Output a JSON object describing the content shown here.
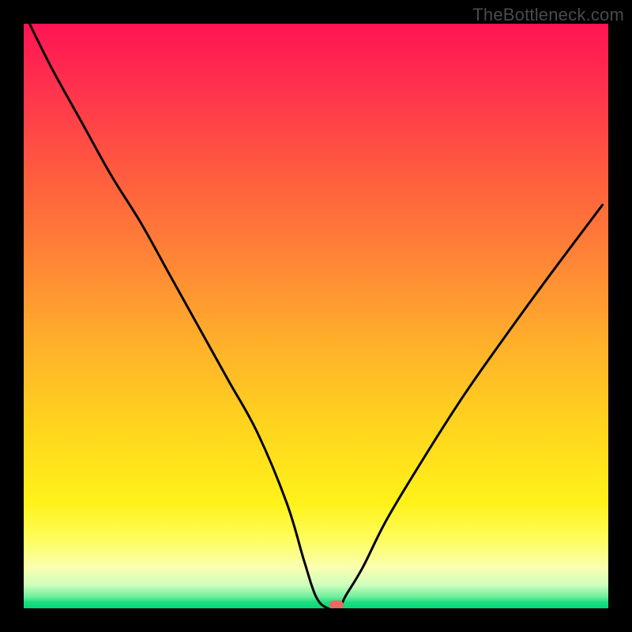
{
  "watermark": "TheBottleneck.com",
  "colors": {
    "curve": "#000000",
    "marker": "#e76b63",
    "frame": "#000000"
  },
  "chart_data": {
    "type": "line",
    "title": "",
    "xlabel": "",
    "ylabel": "",
    "xlim": [
      0,
      100
    ],
    "ylim": [
      0,
      100
    ],
    "grid": false,
    "annotations": [
      "TheBottleneck.com"
    ],
    "series": [
      {
        "name": "bottleneck-curve",
        "x": [
          1,
          5,
          10,
          15,
          20,
          25,
          30,
          35,
          40,
          45,
          48,
          50,
          52,
          54,
          55,
          58,
          62,
          68,
          75,
          82,
          90,
          99
        ],
        "y": [
          100,
          92,
          83,
          74,
          66,
          57,
          48,
          39,
          30,
          18,
          8,
          2,
          0,
          0,
          2,
          7,
          15,
          25,
          36,
          46,
          57,
          69
        ]
      }
    ],
    "marker": {
      "x": 53.5,
      "y": 0
    }
  }
}
